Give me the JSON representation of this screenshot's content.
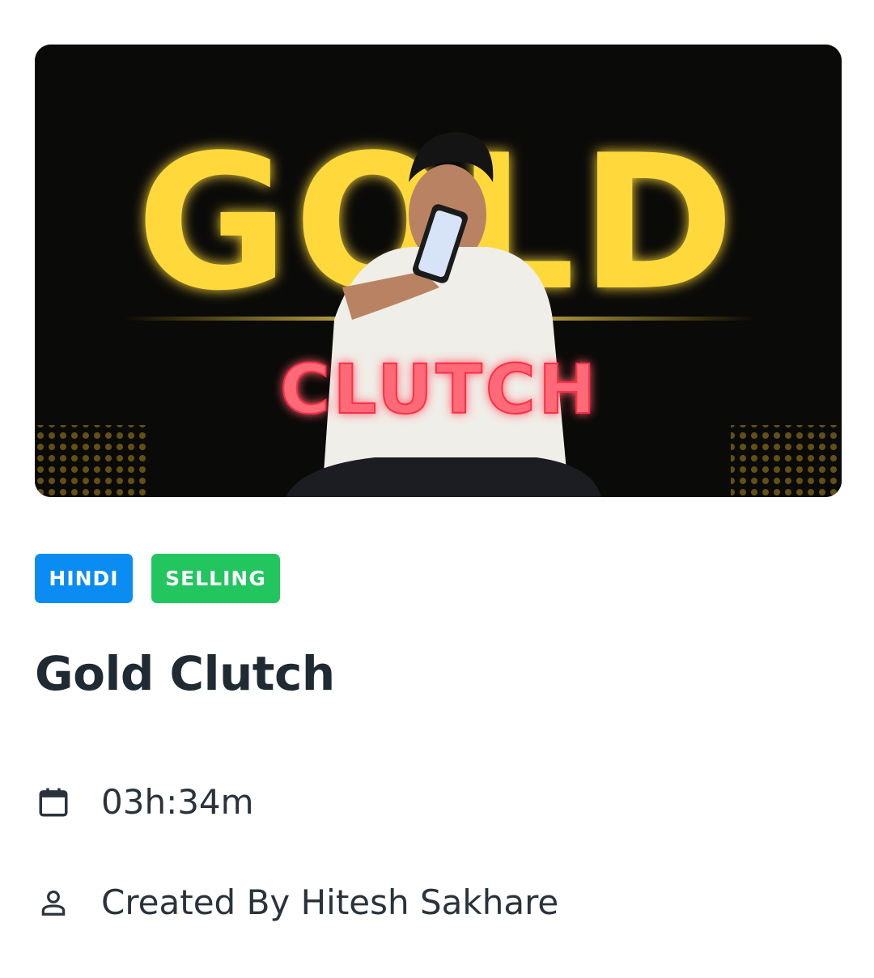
{
  "thumbnail": {
    "headline": "GOLD",
    "subheadline": "CLUTCH",
    "headline_color": "#ffd93b",
    "subheadline_color": "#ff5a6a"
  },
  "tags": [
    {
      "label": "HINDI",
      "color": "#0a8cf2"
    },
    {
      "label": "SELLING",
      "color": "#22c55e"
    }
  ],
  "course": {
    "title": "Gold Clutch",
    "duration": "03h:34m",
    "creator": "Created By Hitesh Sakhare"
  },
  "icons": {
    "duration": "calendar-icon",
    "creator": "person-icon"
  }
}
